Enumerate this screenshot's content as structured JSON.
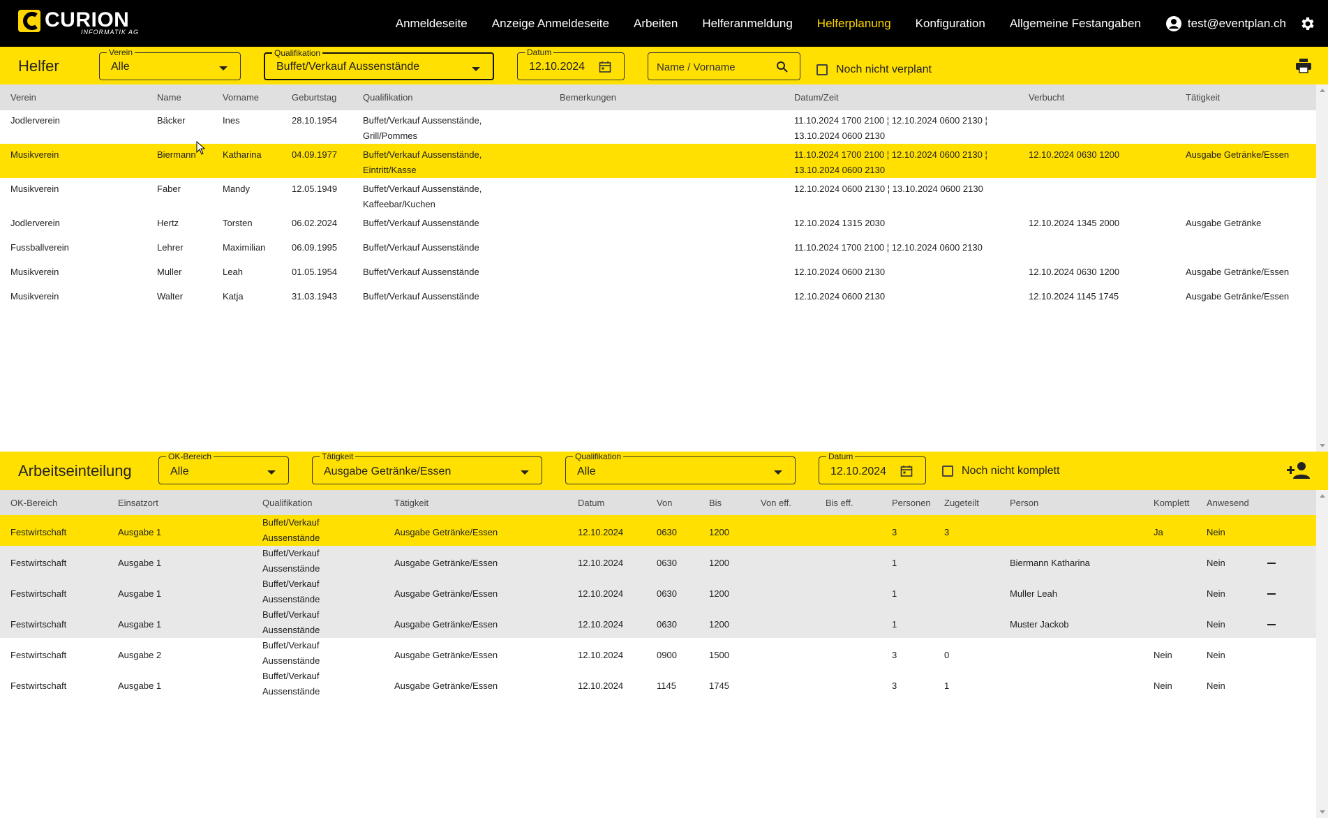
{
  "nav": {
    "logo_text": "CURION",
    "logo_sub": "INFORMATIK AG",
    "items": [
      {
        "label": "Anmeldeseite",
        "active": false
      },
      {
        "label": "Anzeige Anmeldeseite",
        "active": false
      },
      {
        "label": "Arbeiten",
        "active": false
      },
      {
        "label": "Helferanmeldung",
        "active": false
      },
      {
        "label": "Helferplanung",
        "active": true
      },
      {
        "label": "Konfiguration",
        "active": false
      },
      {
        "label": "Allgemeine Festangaben",
        "active": false
      }
    ],
    "user_email": "test@eventplan.ch",
    "accent_color": "#ffd600"
  },
  "helfer": {
    "title": "Helfer",
    "filters": {
      "verein": {
        "label": "Verein",
        "value": "Alle"
      },
      "qualifikation": {
        "label": "Qualifikation",
        "value": "Buffet/Verkauf Aussenstände"
      },
      "datum": {
        "label": "Datum",
        "value": "12.10.2024"
      },
      "search_placeholder": "Name / Vorname",
      "checkbox_label": "Noch nicht verplant"
    },
    "columns": [
      "Verein",
      "Name",
      "Vorname",
      "Geburtstag",
      "Qualifikation",
      "Bemerkungen",
      "Datum/Zeit",
      "Verbucht",
      "Tätigkeit"
    ],
    "rows": [
      {
        "verein": "Jodlerverein",
        "name": "Bäcker",
        "vorname": "Ines",
        "geburtstag": "28.10.1954",
        "qual1": "Buffet/Verkauf Aussenstände,",
        "qual2": "Grill/Pommes",
        "bemerkungen": "",
        "zeit1": "11.10.2024 1700 2100 ¦ 12.10.2024 0600 2130 ¦",
        "zeit2": "13.10.2024 0600 2130",
        "verbucht": "",
        "taetigkeit": ""
      },
      {
        "verein": "Musikverein",
        "name": "Biermann",
        "vorname": "Katharina",
        "geburtstag": "04.09.1977",
        "qual1": "Buffet/Verkauf Aussenstände,",
        "qual2": "Eintritt/Kasse",
        "bemerkungen": "",
        "zeit1": "11.10.2024 1700 2100 ¦ 12.10.2024 0600 2130 ¦",
        "zeit2": "13.10.2024 0600 2130",
        "verbucht": "12.10.2024 0630 1200",
        "taetigkeit": "Ausgabe Getränke/Essen"
      },
      {
        "verein": "Musikverein",
        "name": "Faber",
        "vorname": "Mandy",
        "geburtstag": "12.05.1949",
        "qual1": "Buffet/Verkauf Aussenstände,",
        "qual2": "Kaffeebar/Kuchen",
        "bemerkungen": "",
        "zeit1": "12.10.2024 0600 2130 ¦ 13.10.2024 0600 2130",
        "zeit2": "",
        "verbucht": "",
        "taetigkeit": ""
      },
      {
        "verein": "Jodlerverein",
        "name": "Hertz",
        "vorname": "Torsten",
        "geburtstag": "06.02.2024",
        "qual1": "Buffet/Verkauf Aussenstände",
        "qual2": "",
        "bemerkungen": "",
        "zeit1": "12.10.2024 1315 2030",
        "zeit2": "",
        "verbucht": "12.10.2024 1345 2000",
        "taetigkeit": "Ausgabe Getränke"
      },
      {
        "verein": "Fussballverein",
        "name": "Lehrer",
        "vorname": "Maximilian",
        "geburtstag": "06.09.1995",
        "qual1": "Buffet/Verkauf Aussenstände",
        "qual2": "",
        "bemerkungen": "",
        "zeit1": "11.10.2024 1700 2100 ¦ 12.10.2024 0600 2130",
        "zeit2": "",
        "verbucht": "",
        "taetigkeit": ""
      },
      {
        "verein": "Musikverein",
        "name": "Muller",
        "vorname": "Leah",
        "geburtstag": "01.05.1954",
        "qual1": "Buffet/Verkauf Aussenstände",
        "qual2": "",
        "bemerkungen": "",
        "zeit1": "12.10.2024 0600 2130",
        "zeit2": "",
        "verbucht": "12.10.2024 0630 1200",
        "taetigkeit": "Ausgabe Getränke/Essen"
      },
      {
        "verein": "Musikverein",
        "name": "Walter",
        "vorname": "Katja",
        "geburtstag": "31.03.1943",
        "qual1": "Buffet/Verkauf Aussenstände",
        "qual2": "",
        "bemerkungen": "",
        "zeit1": "12.10.2024 0600 2130",
        "zeit2": "",
        "verbucht": "12.10.2024 1145 1745",
        "taetigkeit": "Ausgabe Getränke/Essen"
      }
    ]
  },
  "arbeit": {
    "title": "Arbeitseinteilung",
    "filters": {
      "okbereich": {
        "label": "OK-Bereich",
        "value": "Alle"
      },
      "taetigkeit": {
        "label": "Tätigkeit",
        "value": "Ausgabe Getränke/Essen"
      },
      "qualifikation": {
        "label": "Qualifikation",
        "value": "Alle"
      },
      "datum": {
        "label": "Datum",
        "value": "12.10.2024"
      },
      "checkbox_label": "Noch nicht komplett"
    },
    "columns": [
      "OK-Bereich",
      "Einsatzort",
      "Qualifikation",
      "Tätigkeit",
      "Datum",
      "Von",
      "Bis",
      "Von eff.",
      "Bis eff.",
      "Personen",
      "Zugeteilt",
      "Person",
      "Komplett",
      "Anwesend"
    ],
    "rows": [
      {
        "ok": "Festwirtschaft",
        "ort": "Ausgabe 1",
        "qual1": "Buffet/Verkauf",
        "qual2": "Aussenstände",
        "taet": "Ausgabe Getränke/Essen",
        "datum": "12.10.2024",
        "von": "0630",
        "bis": "1200",
        "voneff": "",
        "biseff": "",
        "personen": "3",
        "zugeteilt": "3",
        "person": "",
        "komplett": "Ja",
        "anwesend": "Nein",
        "minus": false
      },
      {
        "ok": "Festwirtschaft",
        "ort": "Ausgabe 1",
        "qual1": "Buffet/Verkauf",
        "qual2": "Aussenstände",
        "taet": "Ausgabe Getränke/Essen",
        "datum": "12.10.2024",
        "von": "0630",
        "bis": "1200",
        "voneff": "",
        "biseff": "",
        "personen": "1",
        "zugeteilt": "",
        "person": "Biermann Katharina",
        "komplett": "",
        "anwesend": "Nein",
        "minus": true
      },
      {
        "ok": "Festwirtschaft",
        "ort": "Ausgabe 1",
        "qual1": "Buffet/Verkauf",
        "qual2": "Aussenstände",
        "taet": "Ausgabe Getränke/Essen",
        "datum": "12.10.2024",
        "von": "0630",
        "bis": "1200",
        "voneff": "",
        "biseff": "",
        "personen": "1",
        "zugeteilt": "",
        "person": "Muller Leah",
        "komplett": "",
        "anwesend": "Nein",
        "minus": true
      },
      {
        "ok": "Festwirtschaft",
        "ort": "Ausgabe 1",
        "qual1": "Buffet/Verkauf",
        "qual2": "Aussenstände",
        "taet": "Ausgabe Getränke/Essen",
        "datum": "12.10.2024",
        "von": "0630",
        "bis": "1200",
        "voneff": "",
        "biseff": "",
        "personen": "1",
        "zugeteilt": "",
        "person": "Muster Jackob",
        "komplett": "",
        "anwesend": "Nein",
        "minus": true
      },
      {
        "ok": "Festwirtschaft",
        "ort": "Ausgabe 2",
        "qual1": "Buffet/Verkauf",
        "qual2": "Aussenstände",
        "taet": "Ausgabe Getränke/Essen",
        "datum": "12.10.2024",
        "von": "0900",
        "bis": "1500",
        "voneff": "",
        "biseff": "",
        "personen": "3",
        "zugeteilt": "0",
        "person": "",
        "komplett": "Nein",
        "anwesend": "Nein",
        "minus": false
      },
      {
        "ok": "Festwirtschaft",
        "ort": "Ausgabe 1",
        "qual1": "Buffet/Verkauf",
        "qual2": "Aussenstände",
        "taet": "Ausgabe Getränke/Essen",
        "datum": "12.10.2024",
        "von": "1145",
        "bis": "1745",
        "voneff": "",
        "biseff": "",
        "personen": "3",
        "zugeteilt": "1",
        "person": "",
        "komplett": "Nein",
        "anwesend": "Nein",
        "minus": false
      }
    ]
  }
}
